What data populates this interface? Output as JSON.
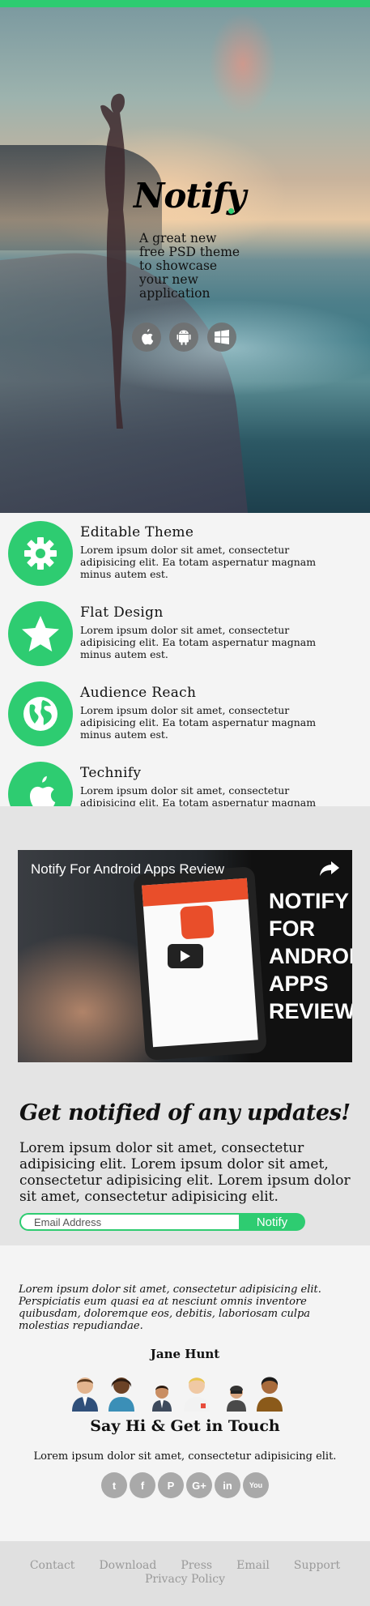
{
  "colors": {
    "accent": "#2ecc71",
    "icon_bg": "#a9a9a9"
  },
  "hero": {
    "brand": "Notify",
    "tagline": "A great new free PSD theme to showcase your new application",
    "stores": [
      {
        "icon": "apple-icon"
      },
      {
        "icon": "android-icon"
      },
      {
        "icon": "windows-icon"
      }
    ]
  },
  "features": [
    {
      "icon": "gear-icon",
      "title": "Editable Theme",
      "text": "Lorem ipsum dolor sit amet, consectetur adipisicing elit. Ea totam aspernatur magnam minus autem est."
    },
    {
      "icon": "star-icon",
      "title": "Flat Design",
      "text": "Lorem ipsum dolor sit amet, consectetur adipisicing elit. Ea totam aspernatur magnam minus autem est."
    },
    {
      "icon": "globe-icon",
      "title": "Audience Reach",
      "text": "Lorem ipsum dolor sit amet, consectetur adipisicing elit. Ea totam aspernatur magnam minus autem est."
    },
    {
      "icon": "apple-icon",
      "title": "Technify",
      "text": "Lorem ipsum dolor sit amet, consectetur adipisicing elit. Ea totam aspernatur magnam minus autem est."
    }
  ],
  "video": {
    "title": "Notify For Android Apps Review",
    "overlay_text": "NOTIFY FOR ANDROID APPS REVIEW"
  },
  "newsletter": {
    "heading": "Get notified of any updates!",
    "text": "Lorem ipsum dolor sit amet, consectetur adipisicing elit. Lorem ipsum dolor sit amet, consectetur adipisicing elit. Lorem ipsum dolor sit amet, consectetur adipisicing elit.",
    "email_placeholder": "Email Address",
    "button": "Notify"
  },
  "testimonial": {
    "quote": "Lorem ipsum dolor sit amet, consectetur adipisicing elit. Perspiciatis eum quasi ea at nesciunt omnis inventore quibusdam, doloremque eos, debitis, laboriosam culpa molestias repudiandae.",
    "author": "Jane Hunt"
  },
  "contact": {
    "title": "Say Hi & Get in Touch",
    "text": "Lorem ipsum dolor sit amet, consectetur adipisicing elit.",
    "socials": [
      {
        "icon": "twitter-icon",
        "glyph": "t"
      },
      {
        "icon": "facebook-icon",
        "glyph": "f"
      },
      {
        "icon": "pinterest-icon",
        "glyph": "P"
      },
      {
        "icon": "google-plus-icon",
        "glyph": "G+"
      },
      {
        "icon": "linkedin-icon",
        "glyph": "in"
      },
      {
        "icon": "youtube-icon",
        "glyph": "You"
      }
    ]
  },
  "footer": {
    "links": [
      "Contact",
      "Download",
      "Press",
      "Email",
      "Support",
      "Privacy Policy"
    ]
  }
}
